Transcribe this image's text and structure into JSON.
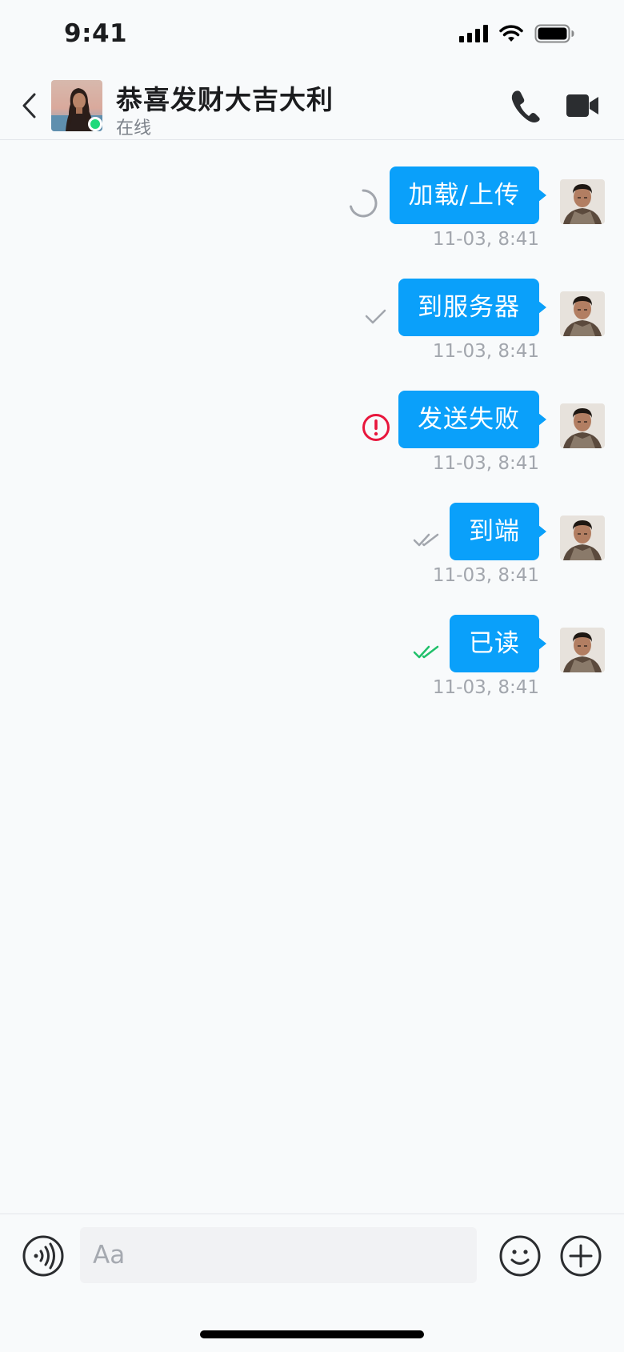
{
  "status_bar": {
    "time": "9:41"
  },
  "header": {
    "contact_name": "恭喜发财大吉大利",
    "contact_status": "在线",
    "online_color": "#20d97a"
  },
  "messages": [
    {
      "text": "加载/上传",
      "time": "11-03, 8:41",
      "status": "loading",
      "status_icon": "loading-spinner-icon"
    },
    {
      "text": "到服务器",
      "time": "11-03, 8:41",
      "status": "sent",
      "status_icon": "single-check-icon"
    },
    {
      "text": "发送失败",
      "time": "11-03, 8:41",
      "status": "failed",
      "status_icon": "error-alert-icon"
    },
    {
      "text": "到端",
      "time": "11-03, 8:41",
      "status": "delivered",
      "status_icon": "double-check-icon"
    },
    {
      "text": "已读",
      "time": "11-03, 8:41",
      "status": "read",
      "status_icon": "double-check-icon"
    }
  ],
  "input": {
    "placeholder": "Aa"
  },
  "colors": {
    "bubble": "#0aa0fa",
    "failed": "#e8163c",
    "read": "#20c06a",
    "muted": "#a2a6ad"
  }
}
